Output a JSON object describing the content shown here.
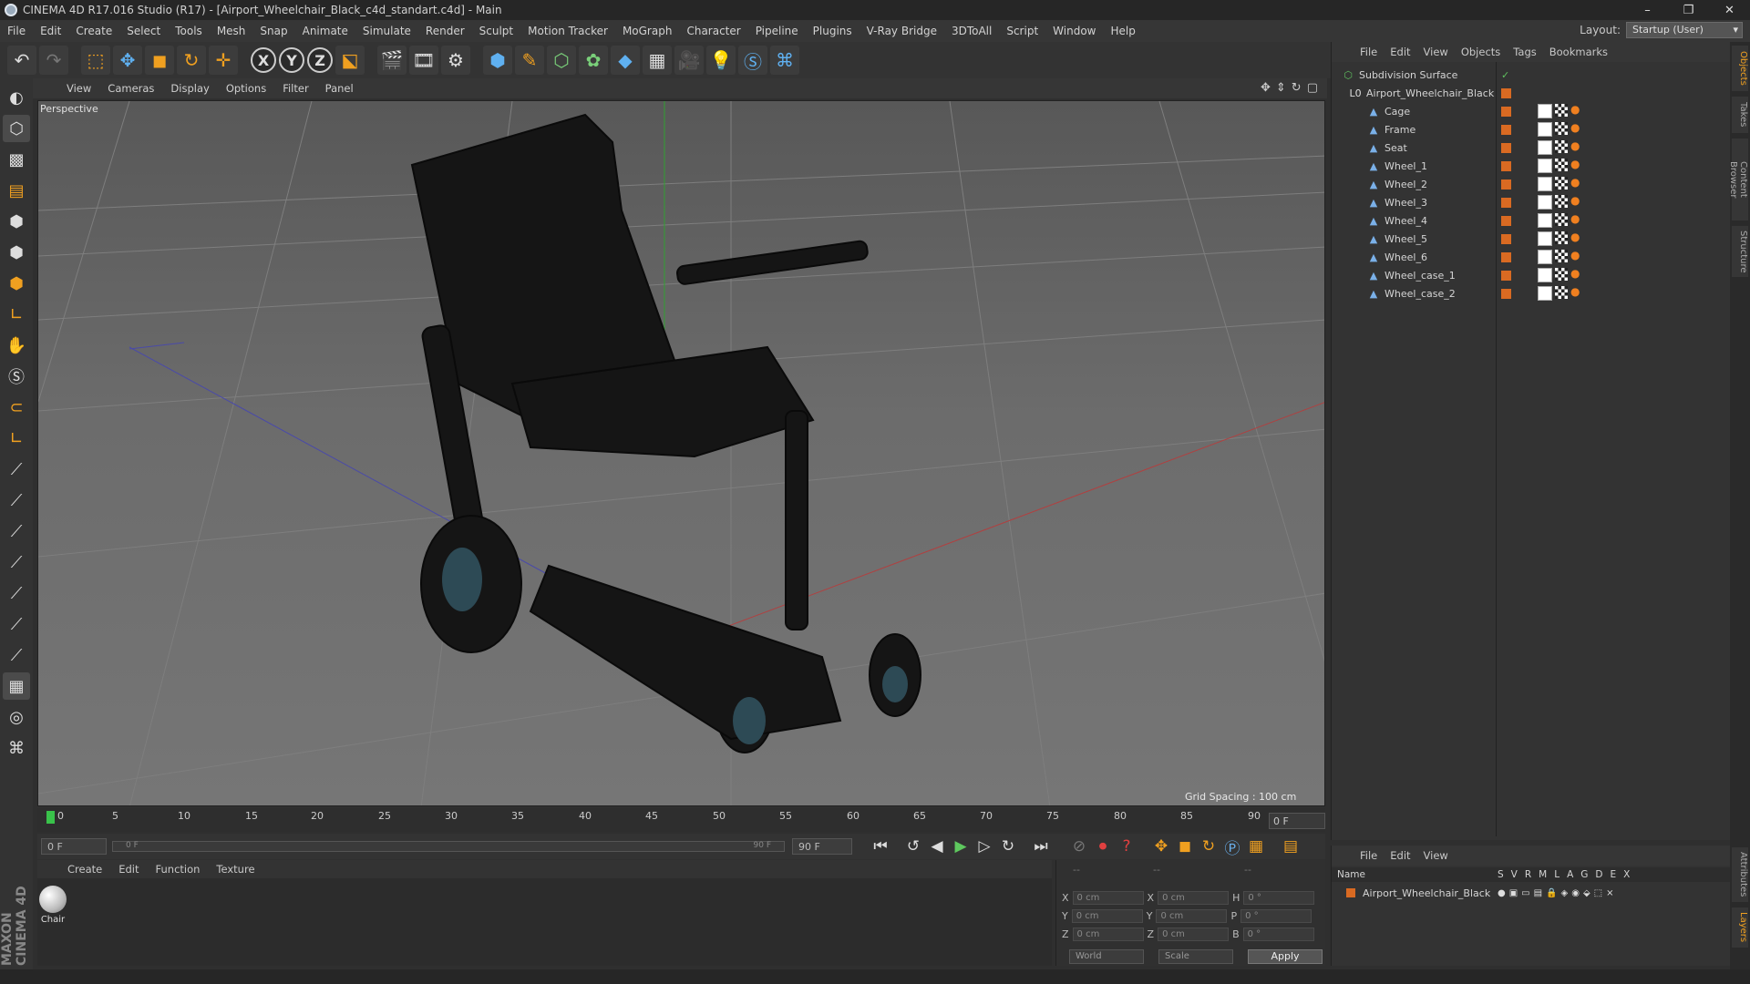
{
  "window": {
    "title": "CINEMA 4D R17.016 Studio (R17) - [Airport_Wheelchair_Black_c4d_standart.c4d] - Main",
    "minimize": "–",
    "restore": "❐",
    "close": "✕"
  },
  "menu": [
    "File",
    "Edit",
    "Create",
    "Select",
    "Tools",
    "Mesh",
    "Snap",
    "Animate",
    "Simulate",
    "Render",
    "Sculpt",
    "Motion Tracker",
    "MoGraph",
    "Character",
    "Pipeline",
    "Plugins",
    "V-Ray Bridge",
    "3DToAll",
    "Script",
    "Window",
    "Help"
  ],
  "layout": {
    "label": "Layout:",
    "value": "Startup (User)"
  },
  "viewport": {
    "menu": [
      "View",
      "Cameras",
      "Display",
      "Options",
      "Filter",
      "Panel"
    ],
    "label": "Perspective",
    "grid_spacing": "Grid Spacing : 100 cm"
  },
  "timeline": {
    "ticks": [
      "0",
      "5",
      "10",
      "15",
      "20",
      "25",
      "30",
      "35",
      "40",
      "45",
      "50",
      "55",
      "60",
      "65",
      "70",
      "75",
      "80",
      "85",
      "90"
    ],
    "current": "0 F",
    "start": "0 F",
    "slider_start": "0 F",
    "slider_end": "90 F",
    "end": "90 F"
  },
  "materials": {
    "menu": [
      "Create",
      "Edit",
      "Function",
      "Texture"
    ],
    "items": [
      {
        "name": "Chair"
      }
    ]
  },
  "coords": {
    "rows": [
      {
        "a": "X",
        "av": "0 cm",
        "b": "X",
        "bv": "0 cm",
        "c": "H",
        "cv": "0 °"
      },
      {
        "a": "Y",
        "av": "0 cm",
        "b": "Y",
        "bv": "0 cm",
        "c": "P",
        "cv": "0 °"
      },
      {
        "a": "Z",
        "av": "0 cm",
        "b": "Z",
        "bv": "0 cm",
        "c": "B",
        "cv": "0 °"
      }
    ],
    "header1": "--",
    "header2": "--",
    "header3": "--",
    "mode": "World",
    "scale": "Scale",
    "apply": "Apply"
  },
  "objects": {
    "menu": [
      "File",
      "Edit",
      "View",
      "Objects",
      "Tags",
      "Bookmarks"
    ],
    "root": "Subdivision Surface",
    "group": "Airport_Wheelchair_Black",
    "children": [
      "Cage",
      "Frame",
      "Seat",
      "Wheel_1",
      "Wheel_2",
      "Wheel_3",
      "Wheel_4",
      "Wheel_5",
      "Wheel_6",
      "Wheel_case_1",
      "Wheel_case_2"
    ]
  },
  "attributes": {
    "menu": [
      "File",
      "Edit",
      "View"
    ],
    "columns": {
      "name": "Name",
      "flags": [
        "S",
        "V",
        "R",
        "M",
        "L",
        "A",
        "G",
        "D",
        "E",
        "X"
      ]
    },
    "row": "Airport_Wheelchair_Black"
  },
  "side_tabs": [
    "Objects",
    "Takes",
    "Content Browser",
    "Structure"
  ],
  "side_tabs_bottom": [
    "Attributes",
    "Layers"
  ],
  "brand": "MAXON CINEMA 4D",
  "colors": {
    "accent": "#f0a020",
    "object_tag": "#d96a22",
    "timeline_cursor": "#39c24a"
  }
}
